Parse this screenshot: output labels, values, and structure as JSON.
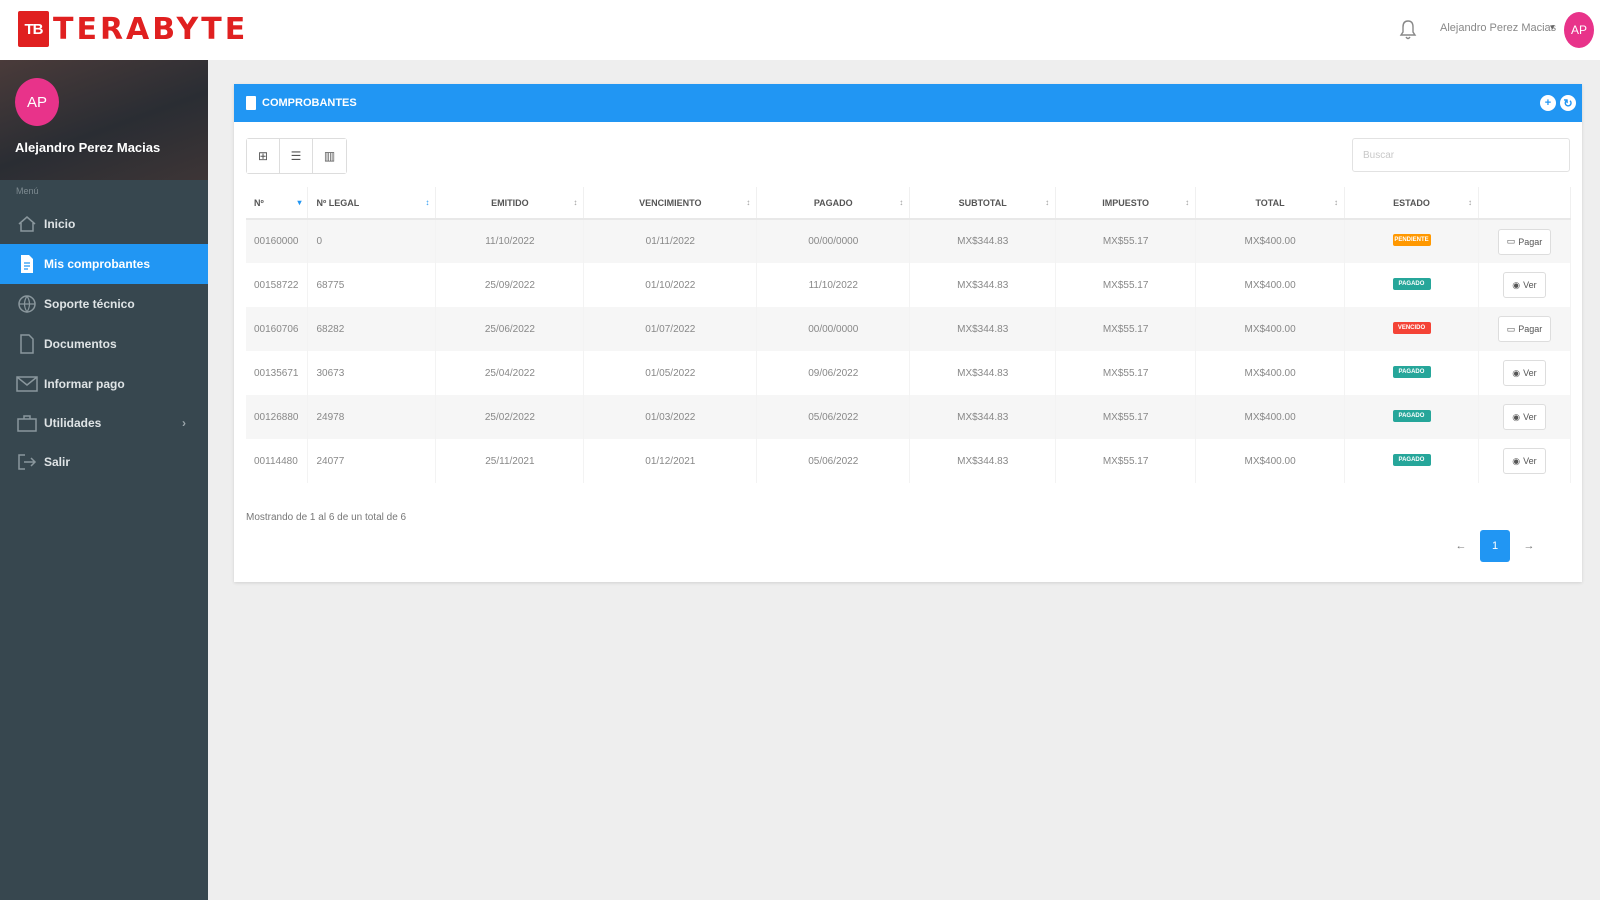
{
  "brand": {
    "logo_mark": "TB",
    "name": "TERABYTE",
    "color": "#e02020"
  },
  "topbar": {
    "user_name": "Alejandro Perez Macias",
    "avatar_initials": "AP"
  },
  "sidebar": {
    "avatar_initials": "AP",
    "user_name": "Alejandro Perez Macias",
    "menu_label": "Menú",
    "items": [
      {
        "label": "Inicio",
        "icon": "home-icon"
      },
      {
        "label": "Mis comprobantes",
        "icon": "document-icon",
        "active": true
      },
      {
        "label": "Soporte técnico",
        "icon": "globe-icon"
      },
      {
        "label": "Documentos",
        "icon": "file-icon"
      },
      {
        "label": "Informar pago",
        "icon": "mail-icon"
      },
      {
        "label": "Utilidades",
        "icon": "briefcase-icon",
        "has_submenu": true
      },
      {
        "label": "Salir",
        "icon": "logout-icon"
      }
    ]
  },
  "panel": {
    "title": "COMPROBANTES",
    "search_placeholder": "Buscar",
    "columns": [
      "Nº",
      "Nº LEGAL",
      "EMITIDO",
      "VENCIMIENTO",
      "PAGADO",
      "SUBTOTAL",
      "IMPUESTO",
      "TOTAL",
      "ESTADO",
      ""
    ],
    "rows": [
      {
        "num": "00160000",
        "legal": "0",
        "emitido": "11/10/2022",
        "vencimiento": "01/11/2022",
        "pagado": "00/00/0000",
        "subtotal": "MX$344.83",
        "impuesto": "MX$55.17",
        "total": "MX$400.00",
        "estado": "PENDIENTE",
        "estado_color": "#ff9800",
        "action": "Pagar"
      },
      {
        "num": "00158722",
        "legal": "68775",
        "emitido": "25/09/2022",
        "vencimiento": "01/10/2022",
        "pagado": "11/10/2022",
        "subtotal": "MX$344.83",
        "impuesto": "MX$55.17",
        "total": "MX$400.00",
        "estado": "PAGADO",
        "estado_color": "#26a69a",
        "action": "Ver"
      },
      {
        "num": "00160706",
        "legal": "68282",
        "emitido": "25/06/2022",
        "vencimiento": "01/07/2022",
        "pagado": "00/00/0000",
        "subtotal": "MX$344.83",
        "impuesto": "MX$55.17",
        "total": "MX$400.00",
        "estado": "VENCIDO",
        "estado_color": "#f44336",
        "action": "Pagar"
      },
      {
        "num": "00135671",
        "legal": "30673",
        "emitido": "25/04/2022",
        "vencimiento": "01/05/2022",
        "pagado": "09/06/2022",
        "subtotal": "MX$344.83",
        "impuesto": "MX$55.17",
        "total": "MX$400.00",
        "estado": "PAGADO",
        "estado_color": "#26a69a",
        "action": "Ver"
      },
      {
        "num": "00126880",
        "legal": "24978",
        "emitido": "25/02/2022",
        "vencimiento": "01/03/2022",
        "pagado": "05/06/2022",
        "subtotal": "MX$344.83",
        "impuesto": "MX$55.17",
        "total": "MX$400.00",
        "estado": "PAGADO",
        "estado_color": "#26a69a",
        "action": "Ver"
      },
      {
        "num": "00114480",
        "legal": "24077",
        "emitido": "25/11/2021",
        "vencimiento": "01/12/2021",
        "pagado": "05/06/2022",
        "subtotal": "MX$344.83",
        "impuesto": "MX$55.17",
        "total": "MX$400.00",
        "estado": "PAGADO",
        "estado_color": "#26a69a",
        "action": "Ver"
      }
    ],
    "showing_text": "Mostrando de 1 al 6 de un total de 6",
    "pagination": {
      "prev": "←",
      "current": "1",
      "next": "→"
    }
  },
  "colors": {
    "accent": "#2196f3",
    "sidebar_bg": "#37474f",
    "avatar": "#e8338a"
  }
}
